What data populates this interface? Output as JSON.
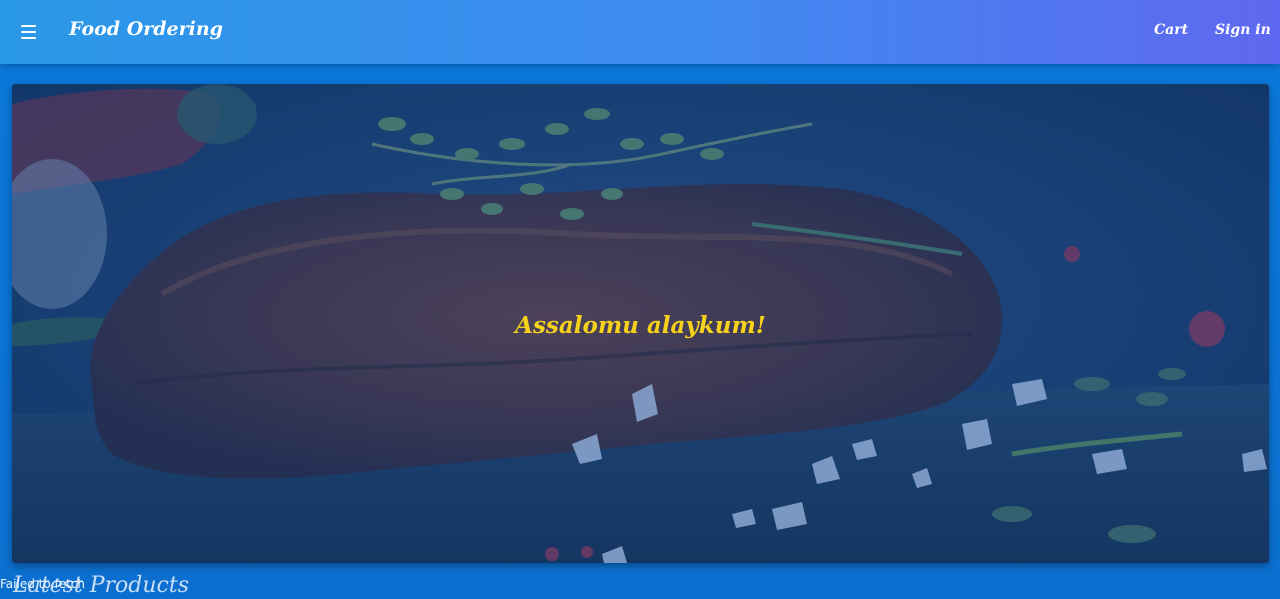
{
  "header": {
    "brand": "Food Ordering",
    "menu_icon": "hamburger-menu-icon",
    "links": {
      "cart": "Cart",
      "sign_in": "Sign in"
    }
  },
  "hero": {
    "title": "Assalomu alaykum!",
    "image_alt_fragment": "Failed to fetch"
  },
  "section": {
    "title": "Latest Products"
  },
  "colors": {
    "header_start": "#2a98e8",
    "header_end": "#5f68f0",
    "background": "#0b74d6",
    "hero_title": "#f6d21a"
  }
}
